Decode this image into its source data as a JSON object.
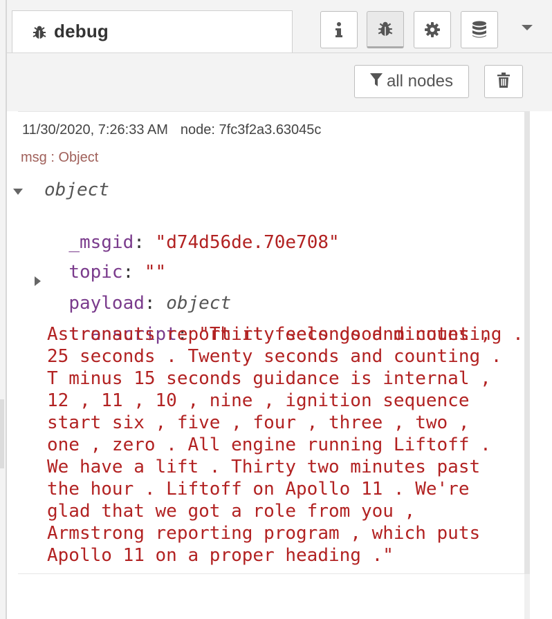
{
  "tab": {
    "icon": "bug-icon",
    "label": "debug"
  },
  "tab_buttons": [
    {
      "name": "info-icon",
      "selected": false
    },
    {
      "name": "bug-icon",
      "selected": true
    },
    {
      "name": "gear-icon",
      "selected": false
    },
    {
      "name": "database-icon",
      "selected": false
    }
  ],
  "toolbar": {
    "filter_label": "all nodes",
    "filter_icon": "filter-icon",
    "clear_icon": "trash-icon"
  },
  "message": {
    "timestamp": "11/30/2020, 7:26:33 AM",
    "node": "node: 7fc3f2a3.63045c",
    "type": "msg : Object",
    "root_label": "object",
    "fields": {
      "msgid_key": "_msgid",
      "msgid_value": "\"d74d56de.70e708\"",
      "topic_key": "topic",
      "topic_value": "\"\"",
      "payload_key": "payload",
      "payload_value": "object",
      "transcript_key": "transcript",
      "transcript_lines": [
        "\"Thirty seconds and counting .",
        "Astronauts report it feels good minutes ,",
        "25 seconds . Twenty seconds and counting .",
        "T minus 15 seconds guidance is internal ,",
        "12 , 11 , 10 , nine , ignition sequence",
        "start six , five , four , three , two ,",
        "one , zero . All engine running Liftoff .",
        "We have a lift . Thirty two minutes past",
        "the hour . Liftoff on Apollo 11 . We're",
        "glad that we got a role from you ,",
        "Armstrong reporting program , which puts",
        "Apollo 11 on a proper heading .\""
      ]
    }
  },
  "colors": {
    "key": "#7a3b8c",
    "string": "#b22222",
    "msg_type": "#a0605a"
  }
}
